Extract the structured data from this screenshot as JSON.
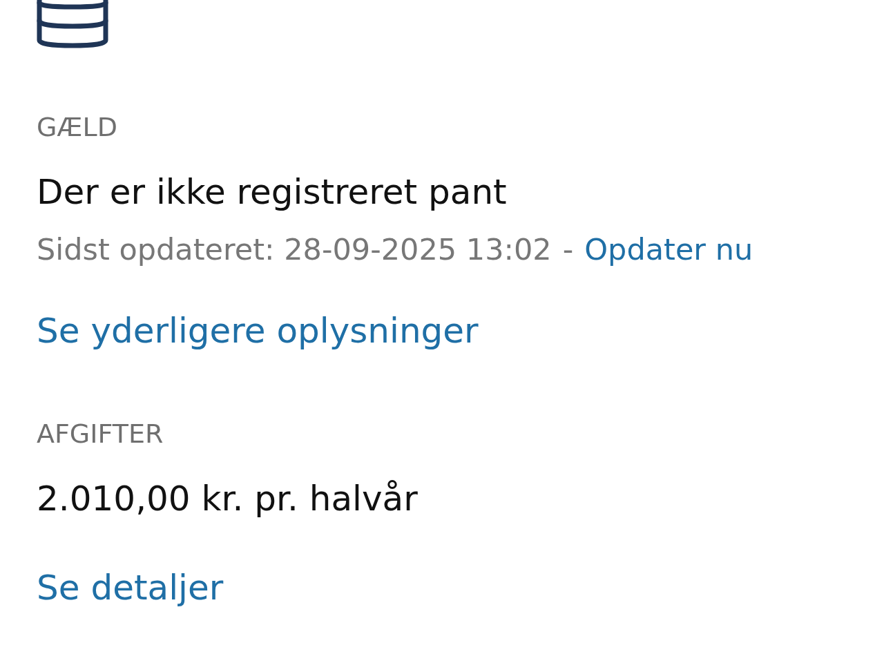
{
  "sections": [
    {
      "kind": "debt",
      "label": "GÆLD",
      "value": "Der er ikke registreret pant",
      "updated": {
        "text": "Sidst opdateret: 28-09-2025 13:02",
        "separator": "-",
        "link": "Opdater nu"
      },
      "link": "Se yderligere oplysninger"
    },
    {
      "kind": "fees",
      "label": "AFGIFTER",
      "value": "2.010,00 kr. pr. halvår",
      "link": "Se detaljer"
    }
  ]
}
